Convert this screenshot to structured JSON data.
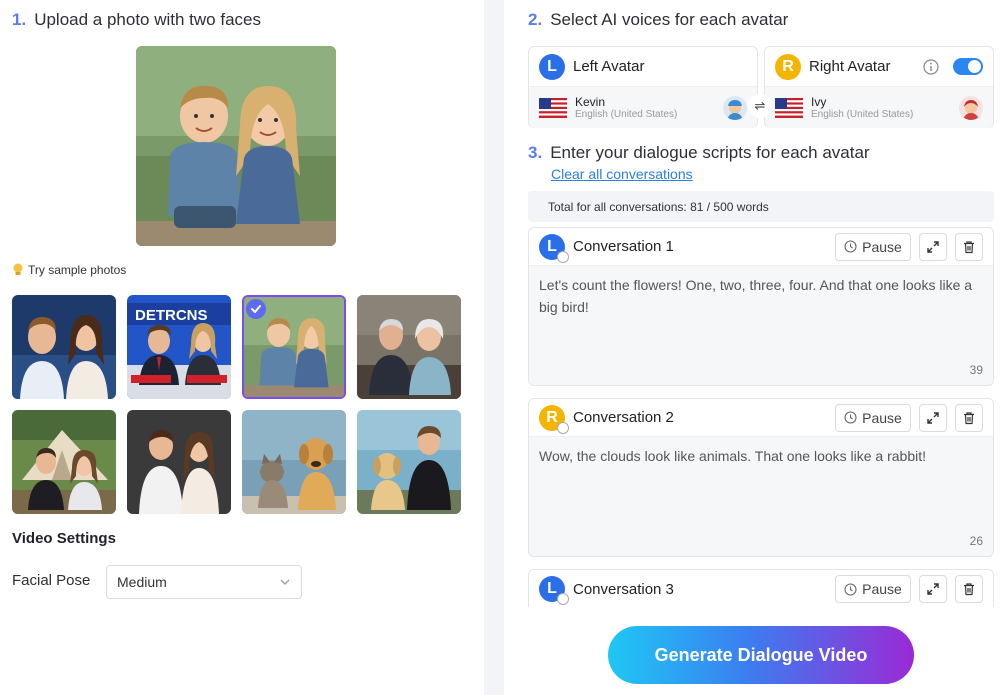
{
  "upload": {
    "step_num": "1.",
    "title": "Upload a photo with two faces",
    "try_sample": "Try sample photos"
  },
  "samples": [
    {
      "id": "couple-news",
      "selected": false
    },
    {
      "id": "news-anchors",
      "selected": false,
      "banner_text": "DETRCNS"
    },
    {
      "id": "kids",
      "selected": true
    },
    {
      "id": "elderly-couple",
      "selected": false
    },
    {
      "id": "camping-couple",
      "selected": false
    },
    {
      "id": "young-couple",
      "selected": false
    },
    {
      "id": "cat-dog",
      "selected": false
    },
    {
      "id": "man-dog",
      "selected": false
    }
  ],
  "video_settings": {
    "title": "Video Settings",
    "facial_pose_label": "Facial Pose",
    "facial_pose_value": "Medium"
  },
  "voices": {
    "step_num": "2.",
    "title": "Select AI voices for each avatar",
    "left": {
      "letter": "L",
      "label": "Left Avatar",
      "voice_name": "Kevin",
      "voice_lang": "English (United States)"
    },
    "right": {
      "letter": "R",
      "label": "Right Avatar",
      "voice_name": "Ivy",
      "voice_lang": "English (United States)",
      "toggle_on": true
    },
    "swap_symbol": "⇌"
  },
  "scripts": {
    "step_num": "3.",
    "title": "Enter your dialogue scripts for each avatar",
    "clear_all": "Clear all conversations",
    "total": "Total for all conversations: 81 / 500 words"
  },
  "conversations": [
    {
      "letter": "L",
      "title": "Conversation 1",
      "pause": "Pause",
      "text": "Let's count the flowers! One, two, three, four. And that one looks like a big bird!",
      "count": "39"
    },
    {
      "letter": "R",
      "title": "Conversation 2",
      "pause": "Pause",
      "text": "Wow, the clouds look like animals. That one looks like a rabbit!",
      "count": "26"
    },
    {
      "letter": "L",
      "title": "Conversation 3",
      "pause": "Pause"
    }
  ],
  "generate_button": "Generate Dialogue Video",
  "colors": {
    "accent": "#5b7cf0",
    "left_avatar": "#2b6fe8",
    "right_avatar": "#f4b400",
    "link": "#2b7fe6",
    "toggle": "#2b86f0"
  }
}
